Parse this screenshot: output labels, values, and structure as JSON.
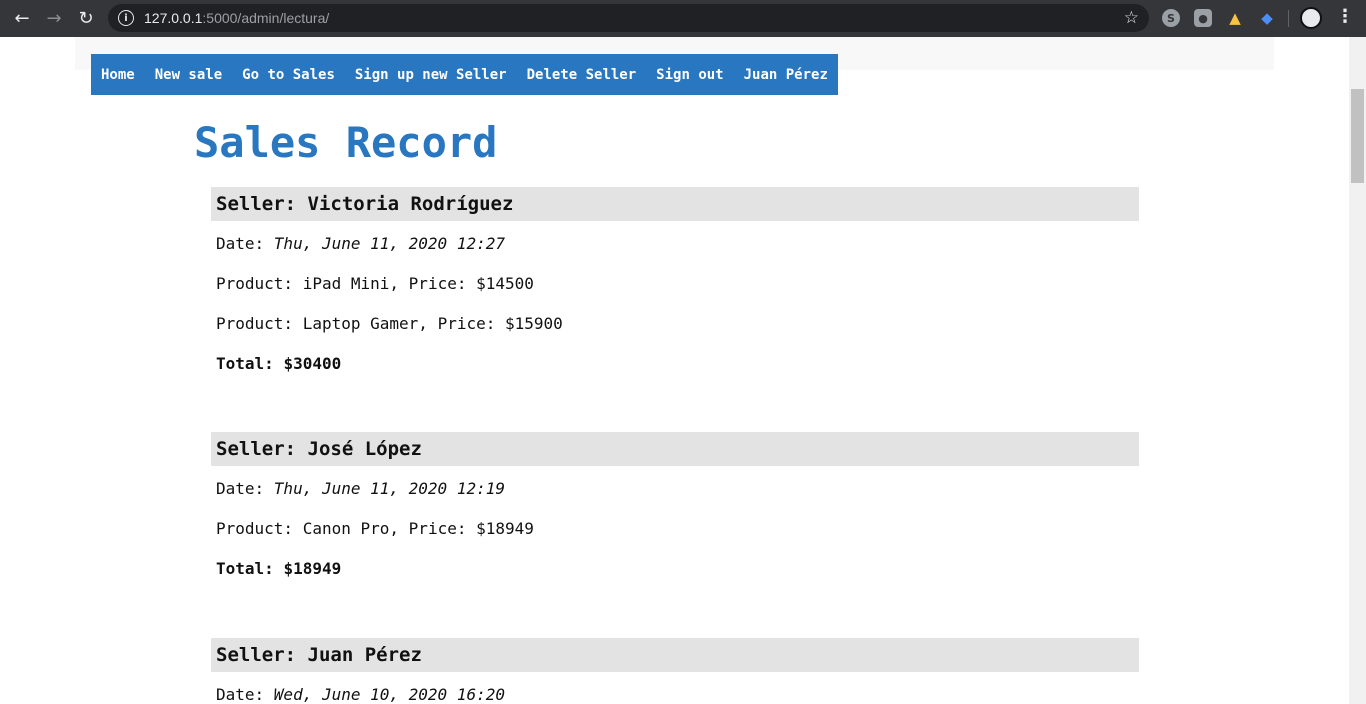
{
  "browser": {
    "url_host": "127.0.0.1",
    "url_path": ":5000/admin/lectura/"
  },
  "menu": [
    "Home",
    "New sale",
    "Go to Sales",
    "Sign up new Seller",
    "Delete Seller",
    "Sign out",
    "Juan Pérez"
  ],
  "page_title": "Sales Record",
  "labels": {
    "seller": "Seller: ",
    "date": "Date: ",
    "product": "Product: ",
    "price": ", Price: ",
    "total": "Total: "
  },
  "sales": [
    {
      "seller": "Victoria Rodríguez",
      "date": "Thu, June 11, 2020 12:27",
      "products": [
        {
          "name": "iPad Mini",
          "price": "$14500"
        },
        {
          "name": "Laptop Gamer",
          "price": "$15900"
        }
      ],
      "total": "$30400"
    },
    {
      "seller": "José López",
      "date": "Thu, June 11, 2020 12:19",
      "products": [
        {
          "name": "Canon Pro",
          "price": "$18949"
        }
      ],
      "total": "$18949"
    },
    {
      "seller": "Juan Pérez",
      "date": "Wed, June 10, 2020 16:20",
      "products": [],
      "total": ""
    }
  ]
}
